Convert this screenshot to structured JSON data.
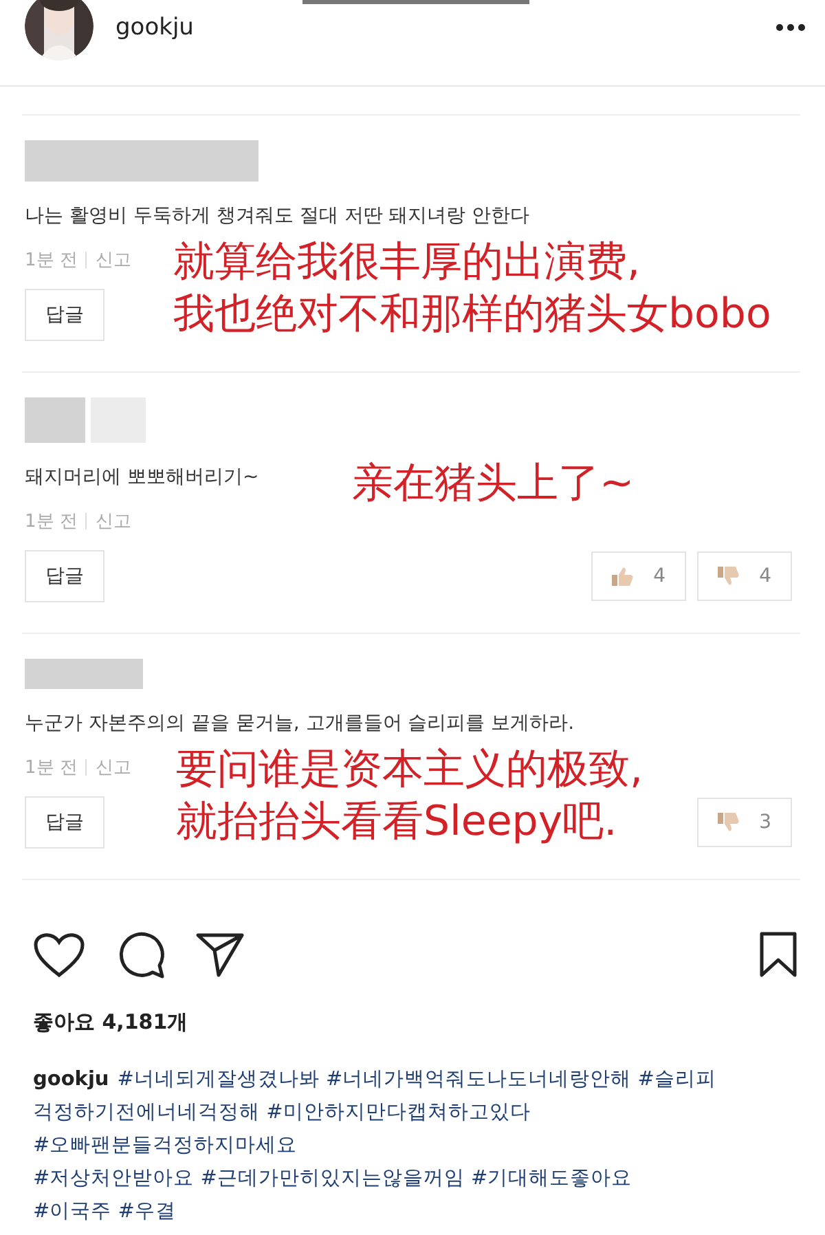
{
  "header": {
    "username": "gookju"
  },
  "comments": [
    {
      "text": "나는 활영비 두둑하게 챙겨줘도 절대 저딴 돼지녀랑 안한다",
      "time": "1분 전",
      "report": "신고",
      "reply": "답글",
      "overlay": [
        "就算给我很丰厚的出演费,",
        "我也绝对不和那样的猪头女bobo"
      ],
      "kind": "wide"
    },
    {
      "text": "돼지머리에 뽀뽀해버리기~",
      "time": "1분 전",
      "report": "신고",
      "reply": "답글",
      "likes": "4",
      "dislikes": "4",
      "overlay": [
        "亲在猪头上了~"
      ],
      "kind": "split"
    },
    {
      "text": "누군가 자본주의의 끝을 묻거늘, 고개를들어 슬리피를 보게하라.",
      "time": "1분 전",
      "report": "신고",
      "reply": "답글",
      "dislikes": "3",
      "overlay": [
        "要问谁是资本主义的极致,",
        "就抬抬头看看Sleepy吧."
      ],
      "kind": "short"
    }
  ],
  "likes_label": "좋아요 4,181개",
  "caption": {
    "username": "gookju",
    "lines": [
      "#너네되게잘생겼나봐 #너네가백억줘도나도너네랑안해 #슬리피",
      "걱정하기전에너네걱정해 #미안하지만다캡쳐하고있다",
      "#오빠팬분들걱정하지마세요",
      "#저상처안받아요 #근데가만히있지는않을꺼임 #기대해도좋아요",
      "#이국주 #우결"
    ]
  }
}
